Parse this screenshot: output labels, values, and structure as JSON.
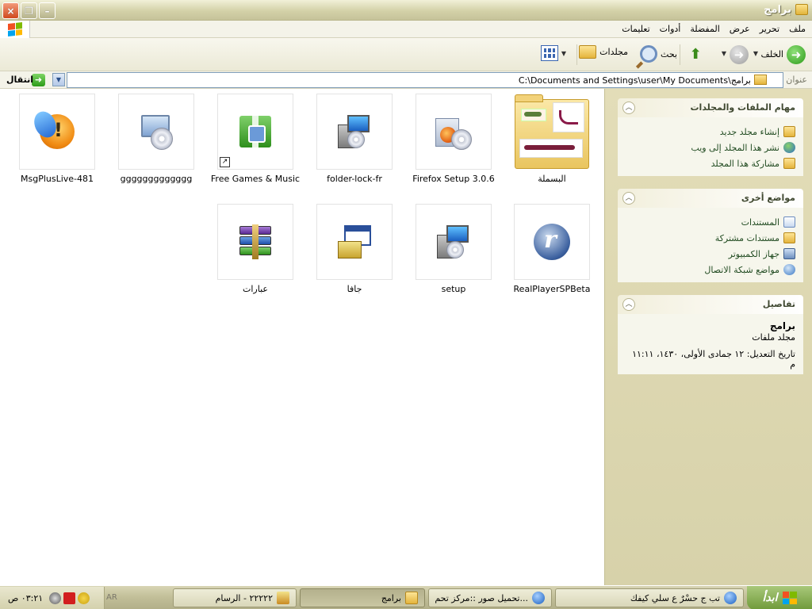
{
  "window": {
    "title": "برامج",
    "buttons": {
      "close": "×",
      "restore": "❐",
      "minimize": "–"
    }
  },
  "menu": [
    "ملف",
    "تحرير",
    "عرض",
    "المفضلة",
    "أدوات",
    "تعليمات"
  ],
  "toolbar": {
    "back_label": "الخلف",
    "search_label": "بحث",
    "folders_label": "مجلدات",
    "views_icon": "views-icon"
  },
  "address": {
    "label": "عنوان",
    "path": "C:\\Documents and Settings\\user\\My Documents\\برامج",
    "go_label": "انتقال"
  },
  "taskpane": {
    "file_tasks": {
      "title": "مهام الملفات والمجلدات",
      "items": [
        "إنشاء مجلد جديد",
        "نشر هذا المجلد إلى ويب",
        "مشاركة هذا المجلد"
      ]
    },
    "other_places": {
      "title": "مواضع أخرى",
      "items": [
        "المستندات",
        "مستندات مشتركة",
        "جهاز الكمبيوتر",
        "مواضع شبكة الاتصال"
      ]
    },
    "details": {
      "title": "تفاصيل",
      "name": "برامج",
      "type": "مجلد ملفات",
      "date": "تاريخ التعديل: ١٢ جمادى الأولى، ١٤٣٠، ١١:١١ م"
    }
  },
  "files": [
    {
      "name": "البسملة",
      "icon": "folder-thumbnail-icon"
    },
    {
      "name": "Firefox Setup 3.0.6",
      "icon": "firefox-setup-icon"
    },
    {
      "name": "folder-lock-fr",
      "icon": "installer-icon"
    },
    {
      "name": "Free Games & Music",
      "icon": "gift-icon"
    },
    {
      "name": "ggggggggggggg",
      "icon": "computer-cd-icon"
    },
    {
      "name": "MsgPlusLive-481",
      "icon": "msgplus-icon"
    },
    {
      "name": "RealPlayerSPBeta",
      "icon": "realplayer-icon"
    },
    {
      "name": "setup",
      "icon": "installer-icon"
    },
    {
      "name": "جافا",
      "icon": "java-installer-icon"
    },
    {
      "name": "عبارات",
      "icon": "winrar-icon"
    }
  ],
  "taskbar": {
    "start_label": "ابدأ",
    "tasks": [
      "تب ج حسْرٌ ع سلي كيفك",
      "تحميل صور ::مركز تحم...",
      "برامج",
      "٢٢٢٢٢ - الرسام"
    ],
    "language": "AR",
    "clock": "٠٣:٢١ ص"
  }
}
